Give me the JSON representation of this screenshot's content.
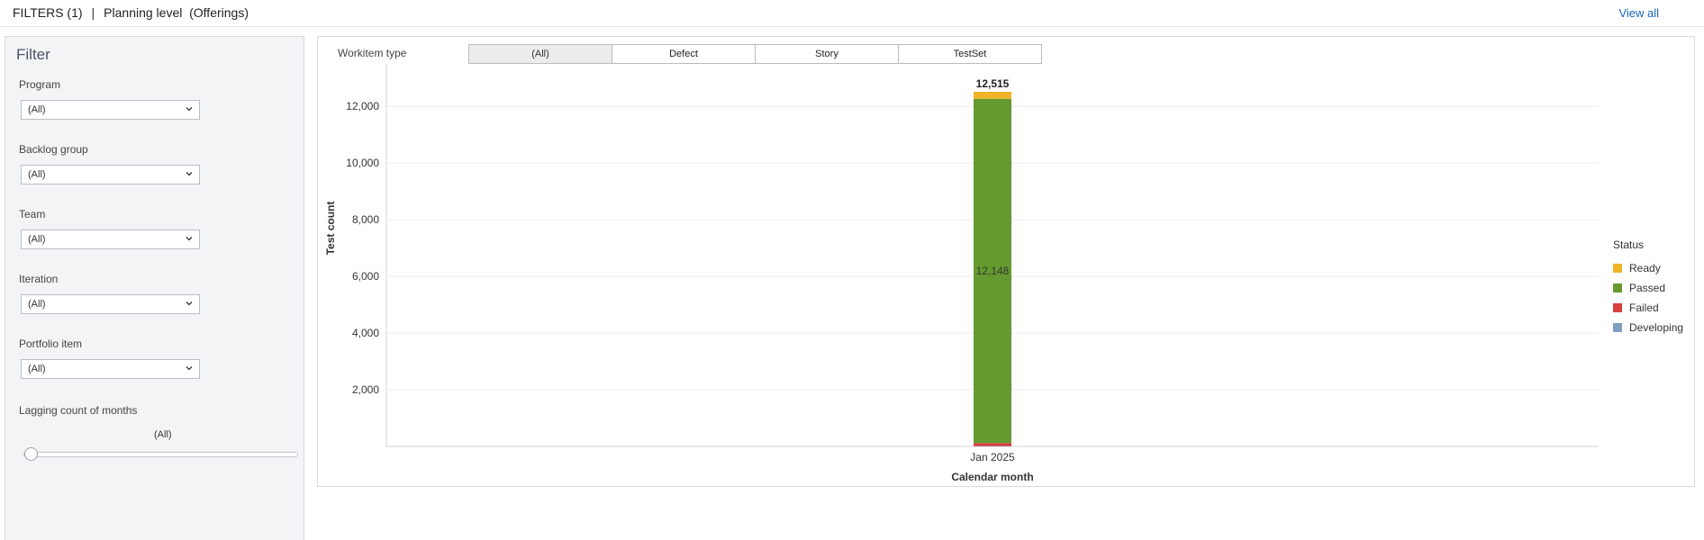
{
  "header": {
    "filters_label": "FILTERS (1)",
    "separator": "|",
    "planning_level": "Planning level  (Offerings)",
    "view_all": "View all"
  },
  "filter_panel": {
    "title": "Filter",
    "filters": [
      {
        "label": "Program",
        "value": "(All)"
      },
      {
        "label": "Backlog group",
        "value": "(All)"
      },
      {
        "label": "Team",
        "value": "(All)"
      },
      {
        "label": "Iteration",
        "value": "(All)"
      },
      {
        "label": "Portfolio item",
        "value": "(All)"
      }
    ],
    "lagging": {
      "label": "Lagging count of months",
      "value": "(All)"
    }
  },
  "workitem_type": {
    "label": "Workitem type",
    "options": [
      "(All)",
      "Defect",
      "Story",
      "TestSet"
    ],
    "selected": "(All)"
  },
  "chart_data": {
    "type": "bar",
    "stacked": true,
    "categories": [
      "Jan 2025"
    ],
    "series": [
      {
        "name": "Developing",
        "values": [
          10
        ],
        "color": "#7f9fc2"
      },
      {
        "name": "Failed",
        "values": [
          110
        ],
        "color": "#d64141"
      },
      {
        "name": "Passed",
        "values": [
          12148
        ],
        "color": "#659a31"
      },
      {
        "name": "Ready",
        "values": [
          247
        ],
        "color": "#f0b429"
      }
    ],
    "totals": [
      12515
    ],
    "total_labels": [
      "12,515"
    ],
    "data_labels": [
      "12,148"
    ],
    "xlabel": "Calendar month",
    "ylabel": "Test count",
    "ylim": [
      0,
      13500
    ],
    "yticks": [
      2000,
      4000,
      6000,
      8000,
      10000,
      12000
    ],
    "ytick_labels": [
      "2,000",
      "4,000",
      "6,000",
      "8,000",
      "10,000",
      "12,000"
    ],
    "grid": true,
    "legend": {
      "title": "Status",
      "placement": "right",
      "items": [
        {
          "name": "Ready",
          "color": "#f0b429"
        },
        {
          "name": "Passed",
          "color": "#659a31"
        },
        {
          "name": "Failed",
          "color": "#d64141"
        },
        {
          "name": "Developing",
          "color": "#7f9fc2"
        }
      ]
    }
  },
  "icons": {
    "dropdown": "chevron-down-icon"
  }
}
